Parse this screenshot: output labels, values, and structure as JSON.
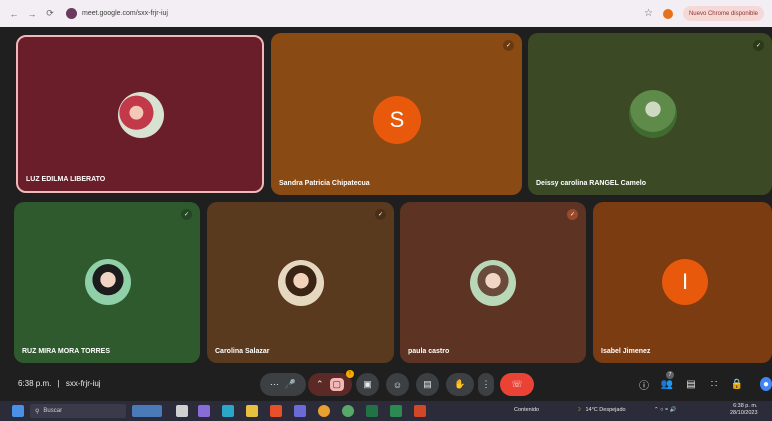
{
  "browser": {
    "url": "meet.google.com/sxx-frjr-iuj",
    "update_label": "Nuevo Chrome disponible"
  },
  "tiles": [
    {
      "name": "LUZ EDILMA LIBERATO"
    },
    {
      "name": "Sandra Patricia Chipatecua",
      "initial": "S"
    },
    {
      "name": "Deissy carolina RANGEL Camelo"
    },
    {
      "name": "RUZ MIRA MORA TORRES"
    },
    {
      "name": "Carolina Salazar"
    },
    {
      "name": "paula castro"
    },
    {
      "name": "Isabel Jimenez",
      "initial": "I"
    }
  ],
  "meeting": {
    "time": "6:38 p.m.",
    "separator": "|",
    "code": "sxx-frjr-iuj",
    "people_count": "7",
    "present_badge": "!"
  },
  "taskbar": {
    "search_placeholder": "Buscar",
    "app_label": "Contenido",
    "weather": "14°C Despejado",
    "clock_time": "6:38 p. m.",
    "clock_date": "28/10/2023"
  },
  "colors": {
    "meet_bg": "#1f1f1f",
    "tile_bg_1": "#6a1e2a",
    "tile_bg_2": "#8a4a14",
    "tile_bg_3": "#3b4a24",
    "tile_bg_4": "#2f5a2e",
    "tile_bg_5": "#5a3a1e",
    "tile_bg_6": "#5d3424",
    "tile_bg_7": "#7a3c10",
    "avatar_orange": "#e8590c",
    "hangup_red": "#ea4335",
    "active_outline": "#f0b8b8"
  },
  "icons": {
    "back": "arrow-left-icon",
    "forward": "arrow-right-icon",
    "reload": "reload-icon",
    "mic": "mic-icon",
    "camera_off": "camera-off-icon",
    "present": "present-screen-icon",
    "emoji": "emoji-icon",
    "captions": "captions-icon",
    "hand": "raise-hand-icon",
    "more": "more-vert-icon",
    "hangup": "hangup-icon",
    "info": "info-icon",
    "people": "people-icon",
    "chat": "chat-icon",
    "activities": "activities-icon",
    "lock": "host-controls-icon"
  }
}
